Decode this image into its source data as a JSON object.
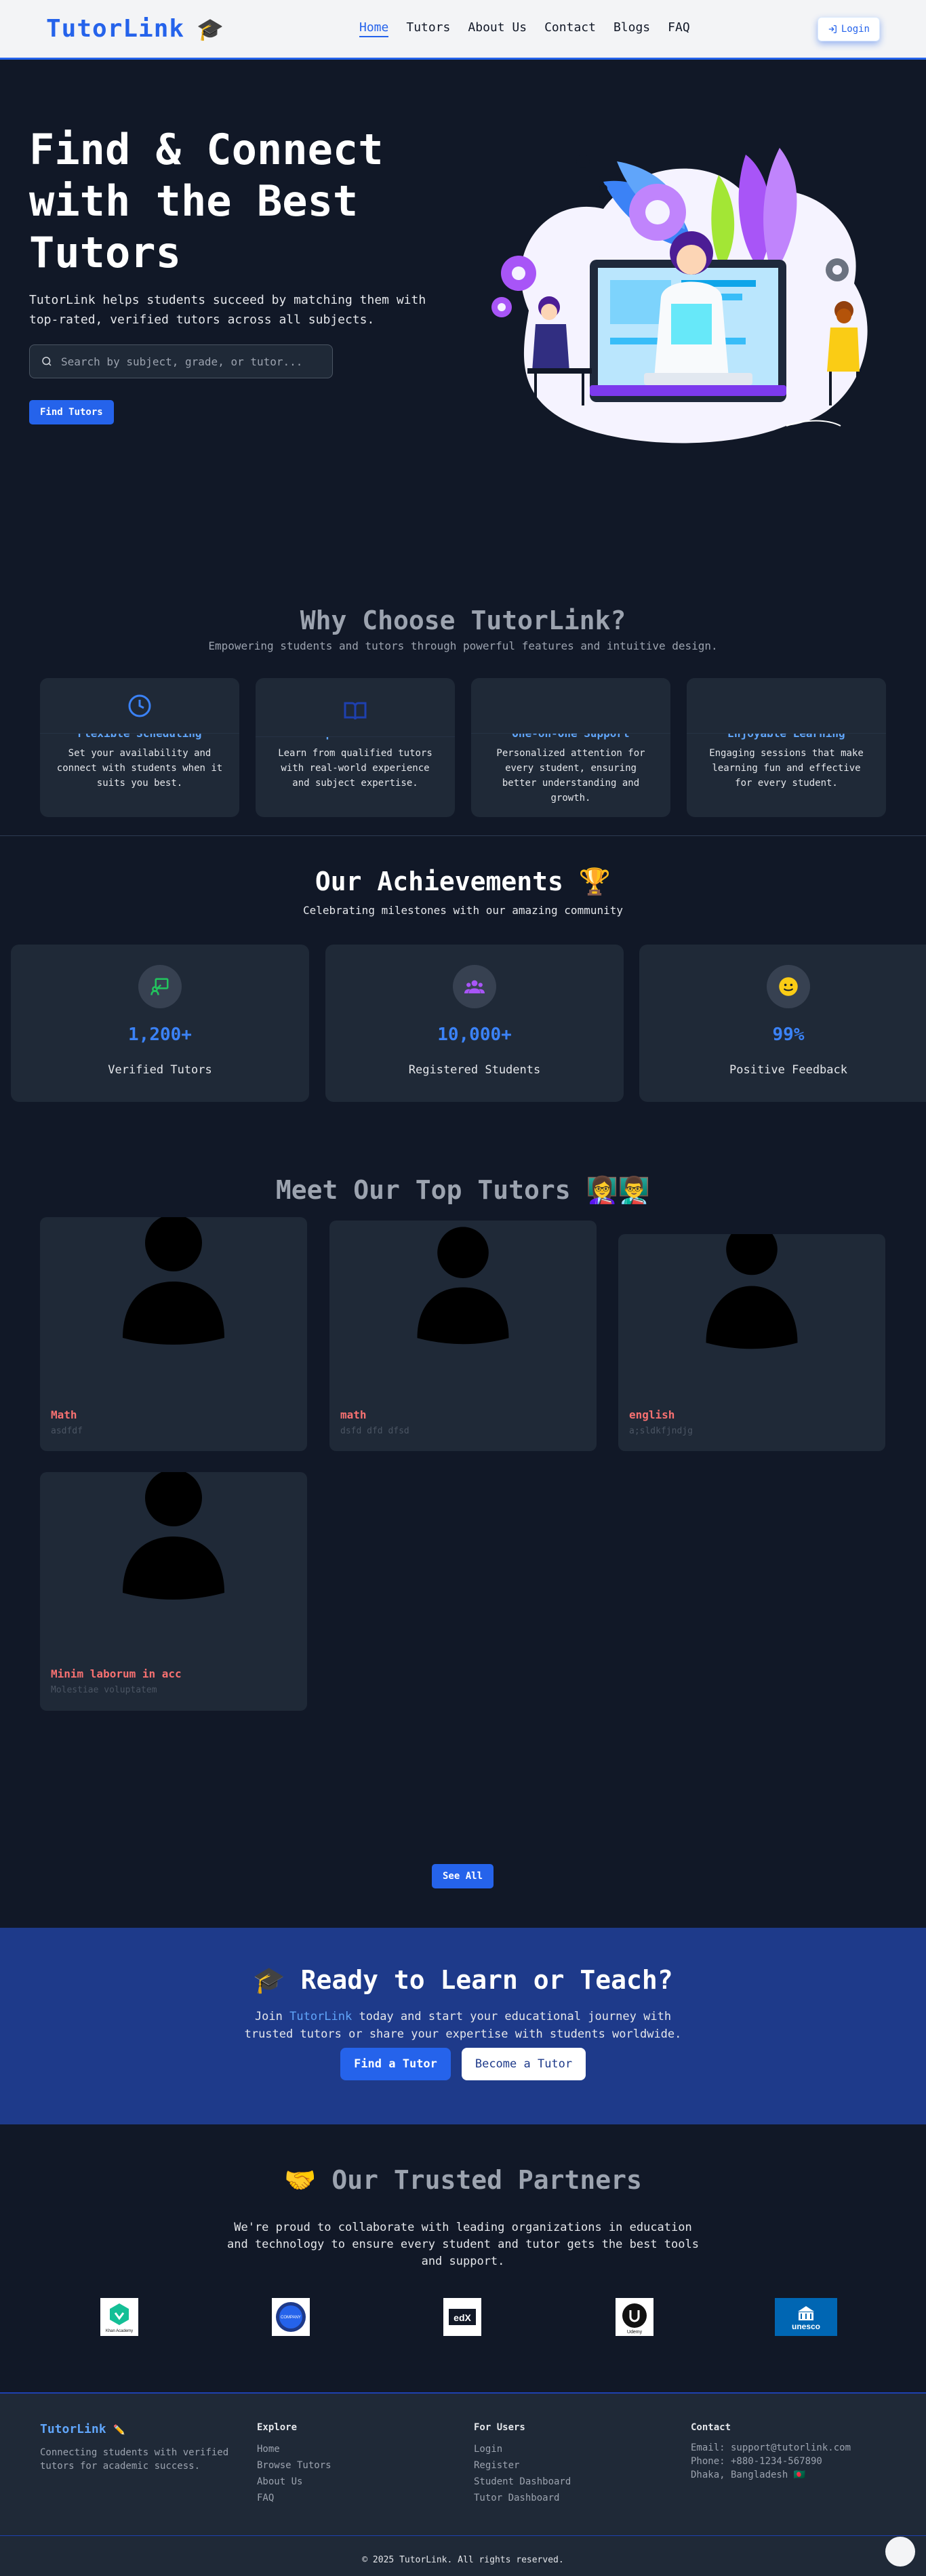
{
  "header": {
    "brand": "TutorLink",
    "nav": [
      "Home",
      "Tutors",
      "About Us",
      "Contact",
      "Blogs",
      "FAQ"
    ],
    "login_label": "Login"
  },
  "hero": {
    "title": "Find & Connect with the Best Tutors",
    "subtitle": "TutorLink helps students succeed by matching them with top-rated, verified tutors across all subjects.",
    "search_placeholder": "Search by subject, grade, or tutor...",
    "cta_label": "Find Tutors"
  },
  "why": {
    "title": "Why Choose TutorLink?",
    "subtitle": "Empowering students and tutors through powerful features and intuitive design.",
    "cards": [
      {
        "title": "Flexible Scheduling",
        "text": "Set your availability and connect with students when it suits you best.",
        "icon": "clock-icon"
      },
      {
        "title": "Expert Tutors",
        "text": "Learn from qualified tutors with real-world experience and subject expertise.",
        "icon": "book-icon"
      },
      {
        "title": "One-on-One Support",
        "text": "Personalized attention for every student, ensuring better understanding and growth.",
        "icon": "support-icon"
      },
      {
        "title": "Enjoyable Learning",
        "text": "Engaging sessions that make learning fun and effective for every student.",
        "icon": "smile-icon"
      }
    ]
  },
  "achievements": {
    "title": "Our Achievements 🏆",
    "subtitle": "Celebrating milestones with our amazing community",
    "items": [
      {
        "value": "1,200+",
        "label": "Verified Tutors",
        "icon": "teacher-icon",
        "color": "#22c55e"
      },
      {
        "value": "10,000+",
        "label": "Registered Students",
        "icon": "users-icon",
        "color": "#a855f7"
      },
      {
        "value": "99%",
        "label": "Positive Feedback",
        "icon": "smile-icon",
        "color": "#facc15"
      }
    ]
  },
  "tutors": {
    "title": "Meet Our Top Tutors 👩‍🏫👨‍🏫",
    "cards": [
      {
        "subject": "Math",
        "desc": "asdfdf"
      },
      {
        "subject": "math",
        "desc": "dsfd dfd dfsd"
      },
      {
        "subject": "english",
        "desc": "a;sldkfjndjg"
      },
      {
        "subject": "Minim laborum in acc",
        "desc": "Molestiae voluptatem"
      }
    ],
    "see_all_label": "See All"
  },
  "cta": {
    "title": "Ready to Learn or Teach?",
    "text_prefix": "Join ",
    "text_highlight": "TutorLink",
    "text_suffix": " today and start your educational journey with trusted tutors or share your expertise with students worldwide.",
    "primary_label": "Find a Tutor",
    "secondary_label": "Become a Tutor"
  },
  "partners": {
    "title": "Our Trusted Partners",
    "text": "We're proud to collaborate with leading organizations in education and technology to ensure every student and tutor gets the best tools and support.",
    "logos": [
      "Khan Academy",
      "COMPANY",
      "edX",
      "Udemy",
      "unesco"
    ]
  },
  "footer": {
    "brand": "TutorLink",
    "tagline": "Connecting students with verified tutors for academic success.",
    "explore_title": "Explore",
    "explore_items": [
      "Home",
      "Browse Tutors",
      "About Us",
      "FAQ"
    ],
    "users_title": "For Users",
    "users_items": [
      "Login",
      "Register",
      "Student Dashboard",
      "Tutor Dashboard"
    ],
    "contact_title": "Contact",
    "email": "Email: support@tutorlink.com",
    "phone": "Phone: +880-1234-567890",
    "address": "Dhaka, Bangladesh 🇧🇩",
    "copyright": "© 2025 TutorLink. All rights reserved."
  },
  "colors": {
    "accent": "#2563eb",
    "background": "#111827",
    "card": "#1f2937",
    "cta_bg": "#1e3a8a",
    "tutor_subject": "#f87171"
  }
}
